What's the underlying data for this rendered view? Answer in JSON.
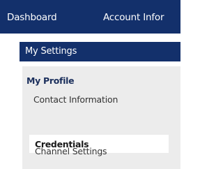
{
  "topnav": {
    "items": [
      "Dashboard",
      "Account Infor"
    ]
  },
  "settings": {
    "title": "My Settings",
    "section_heading": "My Profile",
    "items": [
      {
        "label": "Contact Information",
        "selected": false
      },
      {
        "label": "Credentials",
        "selected": true
      },
      {
        "label": "Channel Settings",
        "selected": false
      }
    ]
  },
  "colors": {
    "nav_background": "#13306b",
    "panel_background": "#ececec",
    "selected_background": "#ffffff"
  }
}
